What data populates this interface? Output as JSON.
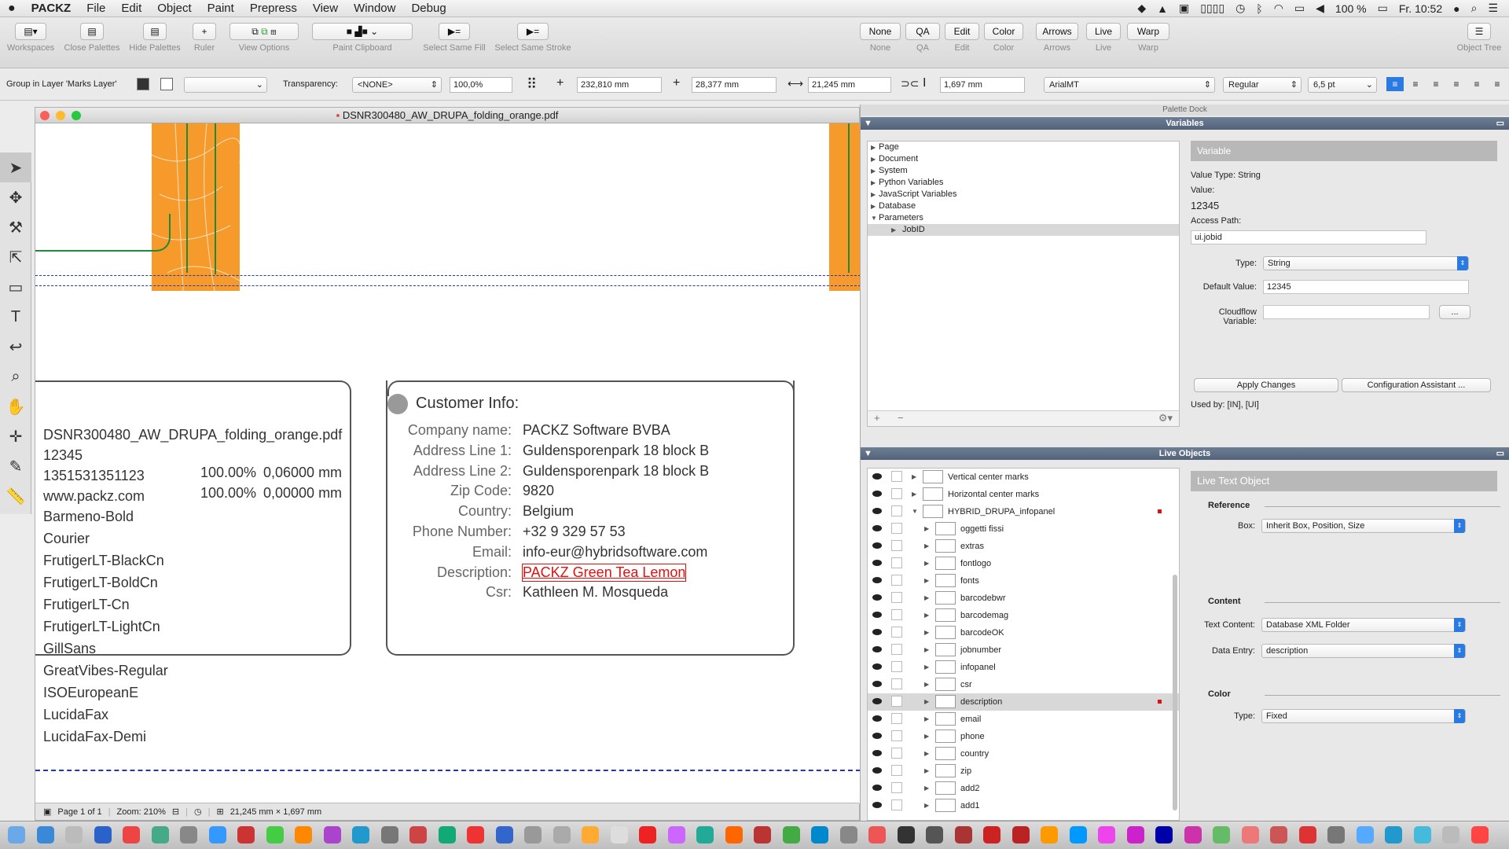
{
  "menubar": {
    "apple": "",
    "app": "PACKZ",
    "items": [
      "File",
      "Edit",
      "Object",
      "Paint",
      "Prepress",
      "View",
      "Window",
      "Debug"
    ],
    "battery": "100 %",
    "clock": "Fr. 10:52"
  },
  "toolbar": {
    "left": [
      {
        "label": "Workspaces",
        "icon": "workspaces-icon"
      },
      {
        "label": "Close Palettes",
        "icon": "close-palettes-icon"
      },
      {
        "label": "Hide Palettes",
        "icon": "hide-palettes-icon"
      },
      {
        "label": "Ruler",
        "icon": "ruler-icon"
      },
      {
        "label": "View Options",
        "icon": "view-options-icon"
      },
      {
        "label": "Paint Clipboard",
        "icon": "paint-clipboard-icon"
      },
      {
        "label": "Select Same Fill",
        "icon": "select-same-fill-icon"
      },
      {
        "label": "Select Same Stroke",
        "icon": "select-same-stroke-icon"
      }
    ],
    "right": [
      {
        "btn": "None",
        "label": "None"
      },
      {
        "btn": "QA",
        "label": "QA"
      },
      {
        "btn": "Edit",
        "label": "Edit"
      },
      {
        "btn": "Color",
        "label": "Color"
      },
      {
        "btn": "Arrows",
        "label": "Arrows"
      },
      {
        "btn": "Live",
        "label": "Live"
      },
      {
        "btn": "Warp",
        "label": "Warp"
      }
    ],
    "object_tree": "Object Tree"
  },
  "control": {
    "group_label": "Group in Layer 'Marks Layer'",
    "transparency_label": "Transparency:",
    "transparency_mode": "<NONE>",
    "opacity": "100,0%",
    "x": "232,810 mm",
    "y": "28,377 mm",
    "width": "21,245 mm",
    "height": "1,697 mm",
    "font": "ArialMT",
    "style": "Regular",
    "size": "6,5 pt"
  },
  "document": {
    "title": "DSNR300480_AW_DRUPA_folding_orange.pdf",
    "left_panel": [
      "DSNR300480_AW_DRUPA_folding_orange.pdf",
      "12345",
      "1351531351123",
      "www.packz.com",
      "Barmeno-Bold",
      "Courier",
      "FrutigerLT-BlackCn",
      "FrutigerLT-BoldCn",
      "FrutigerLT-Cn",
      "FrutigerLT-LightCn",
      "GillSans",
      "GreatVibes-Regular",
      "ISOEuropeanE",
      "LucidaFax",
      "LucidaFax-Demi"
    ],
    "pct": [
      {
        "p": "100.00%",
        "v": "0,06000 mm"
      },
      {
        "p": "100.00%",
        "v": "0,00000 mm"
      }
    ],
    "customer_title": "Customer Info:",
    "customer": [
      {
        "k": "Company name:",
        "v": "PACKZ Software BVBA"
      },
      {
        "k": "Address Line 1:",
        "v": "Guldensporenpark 18 block B"
      },
      {
        "k": "Address Line 2:",
        "v": "Guldensporenpark 18 block B"
      },
      {
        "k": "Zip Code:",
        "v": "9820"
      },
      {
        "k": "Country:",
        "v": "Belgium"
      },
      {
        "k": "Phone Number:",
        "v": "+32 9 329 57 53"
      },
      {
        "k": "Email:",
        "v": "info-eur@hybridsoftware.com"
      },
      {
        "k": "Description:",
        "v": "PACKZ Green Tea Lemon"
      },
      {
        "k": "Csr:",
        "v": "Kathleen M. Mosqueda"
      }
    ],
    "status": {
      "page": "Page 1 of 1",
      "zoom": "Zoom: 210%",
      "dims": "21,245 mm × 1,697 mm"
    }
  },
  "dock": {
    "title": "Palette Dock",
    "variables": {
      "header": "Variables",
      "tree": [
        "Page",
        "Document",
        "System",
        "Python Variables",
        "JavaScript Variables",
        "Database",
        "Parameters"
      ],
      "child": "JobID",
      "box_title": "Variable",
      "value_type": "Value Type: String",
      "value_label": "Value:",
      "value": "12345",
      "access_label": "Access Path:",
      "access_path": "ui.jobid",
      "type_label": "Type:",
      "type": "String",
      "default_label": "Default Value:",
      "default": "12345",
      "cloudflow_label": "Cloudflow Variable:",
      "cloudflow": "",
      "dots": "...",
      "apply": "Apply Changes",
      "assistant": "Configuration Assistant ...",
      "used_by": "Used by: [IN], [UI]"
    },
    "live": {
      "header": "Live Objects",
      "rows": [
        {
          "n": "Vertical center marks",
          "lvl": 0,
          "open": false
        },
        {
          "n": "Horizontal center marks",
          "lvl": 0,
          "open": false
        },
        {
          "n": "HYBRID_DRUPA_infopanel",
          "lvl": 0,
          "open": true,
          "mark": true
        },
        {
          "n": "oggetti fissi",
          "lvl": 1
        },
        {
          "n": "extras",
          "lvl": 1
        },
        {
          "n": "fontlogo",
          "lvl": 1
        },
        {
          "n": "fonts",
          "lvl": 1
        },
        {
          "n": "barcodebwr",
          "lvl": 1
        },
        {
          "n": "barcodemag",
          "lvl": 1
        },
        {
          "n": "barcodeOK",
          "lvl": 1
        },
        {
          "n": "jobnumber",
          "lvl": 1
        },
        {
          "n": "infopanel",
          "lvl": 1
        },
        {
          "n": "csr",
          "lvl": 1
        },
        {
          "n": "description",
          "lvl": 1,
          "sel": true,
          "mark": true
        },
        {
          "n": "email",
          "lvl": 1
        },
        {
          "n": "phone",
          "lvl": 1
        },
        {
          "n": "country",
          "lvl": 1
        },
        {
          "n": "zip",
          "lvl": 1
        },
        {
          "n": "add2",
          "lvl": 1
        },
        {
          "n": "add1",
          "lvl": 1
        }
      ],
      "box_title": "Live Text Object",
      "reference": "Reference",
      "box_label": "Box:",
      "box_value": "Inherit Box, Position, Size",
      "content": "Content",
      "text_content_label": "Text Content:",
      "text_content": "Database XML Folder",
      "data_entry_label": "Data Entry:",
      "data_entry": "description",
      "color": "Color",
      "color_type_label": "Type:",
      "color_type": "Fixed"
    }
  },
  "colors": {
    "orange": "#f59a2b",
    "green": "#1f8a3a",
    "accent": "#2a7ae2",
    "header": "#5d6d82",
    "red": "#e01010"
  }
}
